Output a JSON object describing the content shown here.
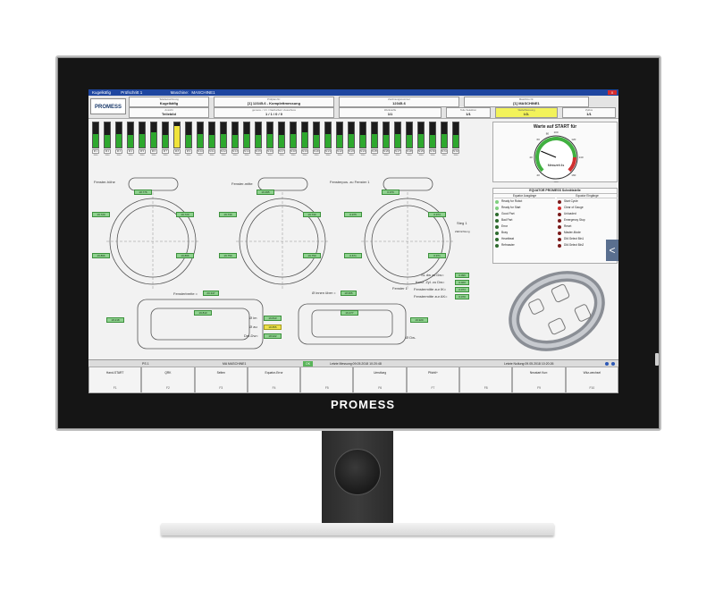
{
  "brand": "PROMESS",
  "titlebar": {
    "app": "Kugelkäfig",
    "step": "Prüfschritt 1",
    "machine_label": "Maschine:",
    "machine": "MASCHINE1",
    "close": "X"
  },
  "header": {
    "logo": "PROMESS",
    "cells": [
      {
        "cap": "Teilebezeichnung",
        "val": "Kugelkäfig",
        "yellow": false
      },
      {
        "cap": "Prüfplan Nr.",
        "val": "[1] 12345-6 - Komplettmessung",
        "yellow": false
      },
      {
        "cap": "Zeichnungsnummer",
        "val": "12345-6",
        "yellow": false
      },
      {
        "cap": "Maschine Nr.",
        "val": "[1] MASCHINE1",
        "yellow": false
      },
      {
        "cap": "Ansicht",
        "val": "Teilebild",
        "yellow": false
      },
      {
        "cap": "gemess. / i.O. / Nacharbeit / Ausschuss",
        "val": "1 / 1 / 0 / 0",
        "yellow": false
      },
      {
        "cap": "Werkstoffe",
        "val": "1/1",
        "yellow": false
      },
      {
        "cap": "Teile Selektion",
        "val": "1/1",
        "yellow": false
      },
      {
        "cap": "Welle/Messung",
        "val": "I.O.",
        "yellow": true
      },
      {
        "cap": "Zyklus",
        "val": "1/1",
        "yellow": false
      }
    ]
  },
  "bars": [
    {
      "label": "M 1",
      "value": 0.55,
      "yellow": false
    },
    {
      "label": "M 2",
      "value": 0.5,
      "yellow": false
    },
    {
      "label": "M 3",
      "value": 0.55,
      "yellow": false
    },
    {
      "label": "M 4",
      "value": 0.5,
      "yellow": false
    },
    {
      "label": "M 5",
      "value": 0.55,
      "yellow": false
    },
    {
      "label": "M 6",
      "value": 0.6,
      "yellow": false
    },
    {
      "label": "M 7",
      "value": 0.5,
      "yellow": false
    },
    {
      "label": "M 8",
      "value": 0.85,
      "yellow": true
    },
    {
      "label": "M 9",
      "value": 0.5,
      "yellow": false
    },
    {
      "label": "M 10",
      "value": 0.55,
      "yellow": false
    },
    {
      "label": "M 11",
      "value": 0.5,
      "yellow": false
    },
    {
      "label": "M 12",
      "value": 0.55,
      "yellow": false
    },
    {
      "label": "M 13",
      "value": 0.5,
      "yellow": false
    },
    {
      "label": "M 14",
      "value": 0.55,
      "yellow": false
    },
    {
      "label": "M 15",
      "value": 0.5,
      "yellow": false
    },
    {
      "label": "M 16",
      "value": 0.55,
      "yellow": false
    },
    {
      "label": "M 17",
      "value": 0.5,
      "yellow": false
    },
    {
      "label": "M 18",
      "value": 0.55,
      "yellow": false
    },
    {
      "label": "M 19",
      "value": 0.6,
      "yellow": false
    },
    {
      "label": "M 20",
      "value": 0.5,
      "yellow": false
    },
    {
      "label": "M 21",
      "value": 0.55,
      "yellow": false
    },
    {
      "label": "M 22",
      "value": 0.5,
      "yellow": false
    },
    {
      "label": "M 23",
      "value": 0.55,
      "yellow": false
    },
    {
      "label": "M 24",
      "value": 0.5,
      "yellow": false
    },
    {
      "label": "M 25",
      "value": 0.55,
      "yellow": false
    },
    {
      "label": "M 26",
      "value": 0.5,
      "yellow": false
    },
    {
      "label": "M 27",
      "value": 0.55,
      "yellow": false
    },
    {
      "label": "M 28",
      "value": 0.5,
      "yellow": false
    },
    {
      "label": "M 29",
      "value": 0.55,
      "yellow": false
    },
    {
      "label": "M 30",
      "value": 0.5,
      "yellow": false
    },
    {
      "label": "M 31",
      "value": 0.55,
      "yellow": false
    },
    {
      "label": "M 32",
      "value": 0.5,
      "yellow": false
    }
  ],
  "bar_value": "2000",
  "drawing": {
    "label1": "Fenster-höhe",
    "label2": "Fenster-mitte",
    "label3": "Fensterpos. zu Fenster 1",
    "steg": "Steg 1",
    "zaehlrichtung": "Zählrichtung",
    "fenster1": "Fenster 1",
    "fensterbreite": "Fensterbreite =",
    "di_innen": "Ø innen über =",
    "di_im": "Ø im",
    "di_au": "Ø au",
    "dmdw": "Dm-Dw=",
    "ddw": "Ø Dw-",
    "sl_label": "SL dw zu Dw=",
    "konz_label": "Konz. Zyl. zu Dw=",
    "fm_label": "Fenstermitte zur IK=",
    "fm2_label": "Fenstermitte zur AK=",
    "values": {
      "v_a": "18.776",
      "v_b": "19.720",
      "v_c": "19.720",
      "v_d": "19.395",
      "v_e": "19.730",
      "v_f": "19.730",
      "v_g": "0.976",
      "v_h": "0.975",
      "v_i": "0.973",
      "v_j": "19.866",
      "v_k": "19.866",
      "v_l": "19.750",
      "v_m": "19.750",
      "v_n": "0.671",
      "v_o": "0.971",
      "sl": "0.096",
      "konz": "0.020",
      "fm": "0.074",
      "fm2": "0.070",
      "fb": "20.347",
      "di": "18.955",
      "w1": "18.218",
      "w2": "19.813",
      "w3": "19.813",
      "w4": "18.855",
      "w5": "18.022",
      "w6": "19.477",
      "w7": "19.920"
    }
  },
  "gauge": {
    "title": "Warte auf START für",
    "center": "Messzeit 4s",
    "value": 0.25,
    "ticks": [
      "100",
      "120",
      "140",
      "160",
      "180",
      "20",
      "40",
      "60",
      "80"
    ]
  },
  "io": {
    "title": "EQUATOR PROMESS Schnittstelle",
    "out_head": "Equator Ausgänge",
    "in_head": "Equator Eingänge",
    "outputs": [
      {
        "label": "Ready for Robot",
        "color": "#7fd07f"
      },
      {
        "label": "Ready for Start",
        "color": "#7fd07f"
      },
      {
        "label": "Good Part",
        "color": "#2e6b2e"
      },
      {
        "label": "Bad Part",
        "color": "#2e6b2e"
      },
      {
        "label": "Error",
        "color": "#2e6b2e"
      },
      {
        "label": "Busy",
        "color": "#2e6b2e"
      },
      {
        "label": "Heartbeat",
        "color": "#2e6b2e"
      },
      {
        "label": "Refmaster",
        "color": "#2e6b2e"
      }
    ],
    "inputs": [
      {
        "label": "Start Cycle",
        "color": "#7a1a1a"
      },
      {
        "label": "Clear of Gauge",
        "color": "#d02a2a"
      },
      {
        "label": "Unloaded",
        "color": "#7a1a1a"
      },
      {
        "label": "Emergency Stop",
        "color": "#7a1a1a"
      },
      {
        "label": "Reset",
        "color": "#7a1a1a"
      },
      {
        "label": "Master-Mode",
        "color": "#7a1a1a"
      },
      {
        "label": "DM-Select Bin1",
        "color": "#7a1a1a"
      },
      {
        "label": "DM-Select Bin2",
        "color": "#7a1a1a"
      }
    ]
  },
  "nav": {
    "back": "<"
  },
  "status": {
    "ps": "PS 1",
    "machine": "MA MASCHINE1",
    "badge": "OK",
    "last_meas": "Letzte Messung:09.05.2018 10:20:48",
    "last_zero": "Letzte Nullung:09.05.2018 10:20:26"
  },
  "fkeys": [
    {
      "label": "Hand-START",
      "key": "F1"
    },
    {
      "label": "QRK",
      "key": "F2"
    },
    {
      "label": "Selten",
      "key": "F3"
    },
    {
      "label": "Equator-Error",
      "key": "F4"
    },
    {
      "label": "",
      "key": "F5"
    },
    {
      "label": "Umstlung",
      "key": "F6"
    },
    {
      "label": "Pfichtl+",
      "key": "F7"
    },
    {
      "label": "",
      "key": "F8"
    },
    {
      "label": "Neustart Kurr.",
      "key": "F9"
    },
    {
      "label": "Wkz-wechsel",
      "key": "F10"
    }
  ]
}
